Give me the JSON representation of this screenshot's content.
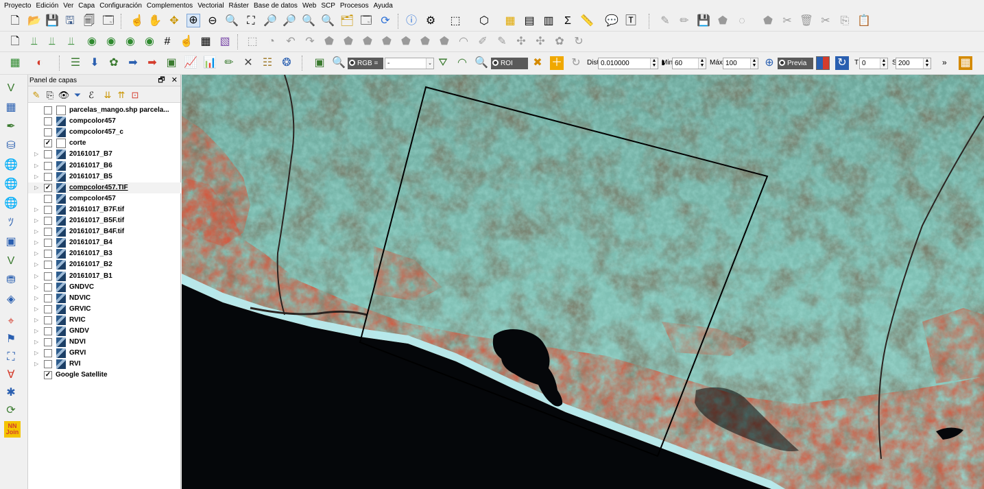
{
  "menu": [
    "Proyecto",
    "Edición",
    "Ver",
    "Capa",
    "Configuración",
    "Complementos",
    "Vectorial",
    "Ráster",
    "Base de datos",
    "Web",
    "SCP",
    "Procesos",
    "Ayuda"
  ],
  "toolbar3": {
    "rgb_label": "RGB =",
    "rgb_value": "-",
    "roi_label": "ROI",
    "dist_label": "Dist",
    "dist_value": "0.010000",
    "min_label": "Min",
    "min_value": "60",
    "max_label": "Máx",
    "max_value": "100",
    "previa_label": "Previa",
    "t_label": "T",
    "t_value": "0",
    "s_label": "S",
    "s_value": "200",
    "more": "»"
  },
  "layers_panel": {
    "title": "Panel de capas",
    "float_btn": "🗗",
    "close_btn": "✕",
    "layers": [
      {
        "name": "parcelas_mango.shp parcela...",
        "checked": false,
        "kind": "vector",
        "expand": false
      },
      {
        "name": "compcolor457",
        "checked": false,
        "kind": "raster",
        "expand": false
      },
      {
        "name": "compcolor457_c",
        "checked": false,
        "kind": "raster",
        "expand": false
      },
      {
        "name": "corte",
        "checked": true,
        "kind": "vector",
        "expand": false
      },
      {
        "name": "20161017_B7",
        "checked": false,
        "kind": "raster",
        "expand": true
      },
      {
        "name": "20161017_B6",
        "checked": false,
        "kind": "raster",
        "expand": true
      },
      {
        "name": "20161017_B5",
        "checked": false,
        "kind": "raster",
        "expand": true
      },
      {
        "name": "compcolor457.TIF",
        "checked": true,
        "kind": "raster",
        "expand": true,
        "selected": true
      },
      {
        "name": "compcolor457",
        "checked": false,
        "kind": "raster",
        "expand": false
      },
      {
        "name": "20161017_B7F.tif",
        "checked": false,
        "kind": "raster",
        "expand": true
      },
      {
        "name": "20161017_B5F.tif",
        "checked": false,
        "kind": "raster",
        "expand": true
      },
      {
        "name": "20161017_B4F.tif",
        "checked": false,
        "kind": "raster",
        "expand": true
      },
      {
        "name": "20161017_B4",
        "checked": false,
        "kind": "raster",
        "expand": true
      },
      {
        "name": "20161017_B3",
        "checked": false,
        "kind": "raster",
        "expand": true
      },
      {
        "name": "20161017_B2",
        "checked": false,
        "kind": "raster",
        "expand": true
      },
      {
        "name": "20161017_B1",
        "checked": false,
        "kind": "raster",
        "expand": true
      },
      {
        "name": "GNDVC",
        "checked": false,
        "kind": "raster",
        "expand": true
      },
      {
        "name": "NDVIC",
        "checked": false,
        "kind": "raster",
        "expand": true
      },
      {
        "name": "GRVIC",
        "checked": false,
        "kind": "raster",
        "expand": true
      },
      {
        "name": "RVIC",
        "checked": false,
        "kind": "raster",
        "expand": true
      },
      {
        "name": "GNDV",
        "checked": false,
        "kind": "raster",
        "expand": true
      },
      {
        "name": "NDVI",
        "checked": false,
        "kind": "raster",
        "expand": true
      },
      {
        "name": "GRVI",
        "checked": false,
        "kind": "raster",
        "expand": true
      },
      {
        "name": "RVI",
        "checked": false,
        "kind": "raster",
        "expand": true
      },
      {
        "name": "Google Satellite",
        "checked": true,
        "kind": "none",
        "expand": false
      }
    ]
  },
  "left_toolbar": {
    "nn_join_label": "NN\nJoin"
  },
  "colors": {
    "sea": "#05070a",
    "vegetation_cyan": "#7fc8bf",
    "hills_brown": "#7a6a55",
    "crops_red": "#d8543a",
    "beach": "#b8ecef"
  }
}
